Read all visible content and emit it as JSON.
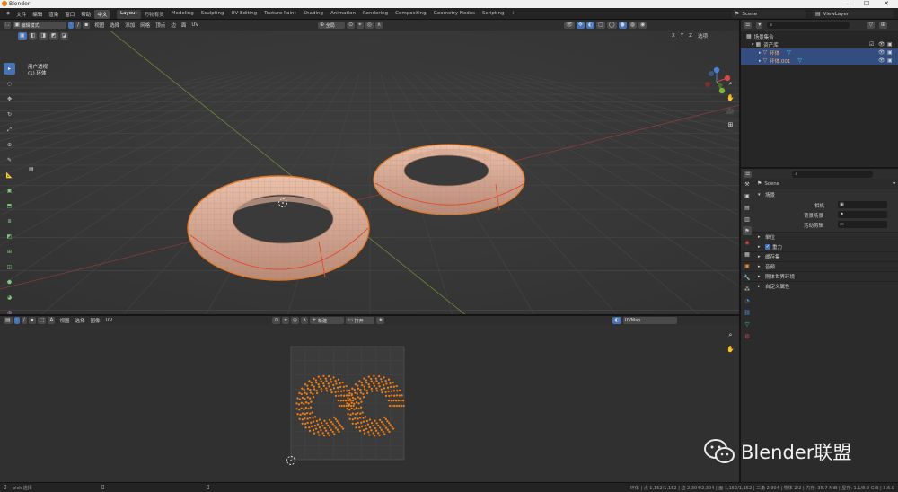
{
  "window": {
    "title": "Blender",
    "controls": [
      "—",
      "☐",
      "✕"
    ]
  },
  "topmenu": {
    "items": [
      "文件",
      "编辑",
      "渲染",
      "窗口",
      "帮助",
      "中文"
    ]
  },
  "workspaces": {
    "tabs": [
      "Layout",
      "万物有灵",
      "Modeling",
      "Sculpting",
      "UV Editing",
      "Texture Paint",
      "Shading",
      "Animation",
      "Rendering",
      "Compositing",
      "Geometry Nodes",
      "Scripting"
    ],
    "active": "Layout",
    "add": "+"
  },
  "scene_selector": {
    "label": "Scene"
  },
  "viewlayer_selector": {
    "label": "ViewLayer"
  },
  "viewport": {
    "mode": "编辑模式",
    "menus": [
      "视图",
      "选择",
      "添加",
      "网格",
      "顶点",
      "边",
      "面",
      "UV"
    ],
    "transform_orientation": "全局",
    "options": "选项",
    "view_name": "用户透视",
    "object_name": "(1) 环体"
  },
  "uv_editor": {
    "menus": [
      "视图",
      "选择",
      "图像",
      "UV"
    ],
    "new_label": "新建",
    "open_label": "打开",
    "uvmap": "UVMap"
  },
  "outliner": {
    "rows": [
      {
        "label": "场景集合",
        "level": 0,
        "selected": false
      },
      {
        "label": "资产库",
        "level": 1,
        "selected": false
      },
      {
        "label": "环体",
        "level": 2,
        "selected": true
      },
      {
        "label": "环体.001",
        "level": 2,
        "selected": true
      }
    ]
  },
  "properties": {
    "scene_label": "Scene",
    "panel_title": "场景",
    "fields": [
      {
        "label": "相机"
      },
      {
        "label": "背景场景"
      },
      {
        "label": "活动剪辑"
      }
    ],
    "sections": [
      "单位",
      "重力",
      "缓存集",
      "音频",
      "刚体世界环境",
      "自定义属性"
    ],
    "gravity_checked": true
  },
  "statusbar": {
    "left": "pick 选择",
    "middle": "平移视图",
    "stats": "环体 | 点 1,152/1,152 | 边 2,304/2,304 | 面 1,152/1,152 | 三角 2,304 | 物体 2/2 | 内存: 35.7 MiB | 显存: 1.1/8.0 GiB | 3.6.0"
  },
  "watermark": {
    "brand": "Blender联盟"
  },
  "colors": {
    "accent": "#4772b3",
    "mesh": "#e1ab94",
    "seam": "#e0452f",
    "uv_vertex": "#f07c14",
    "selection": "#334d80"
  }
}
